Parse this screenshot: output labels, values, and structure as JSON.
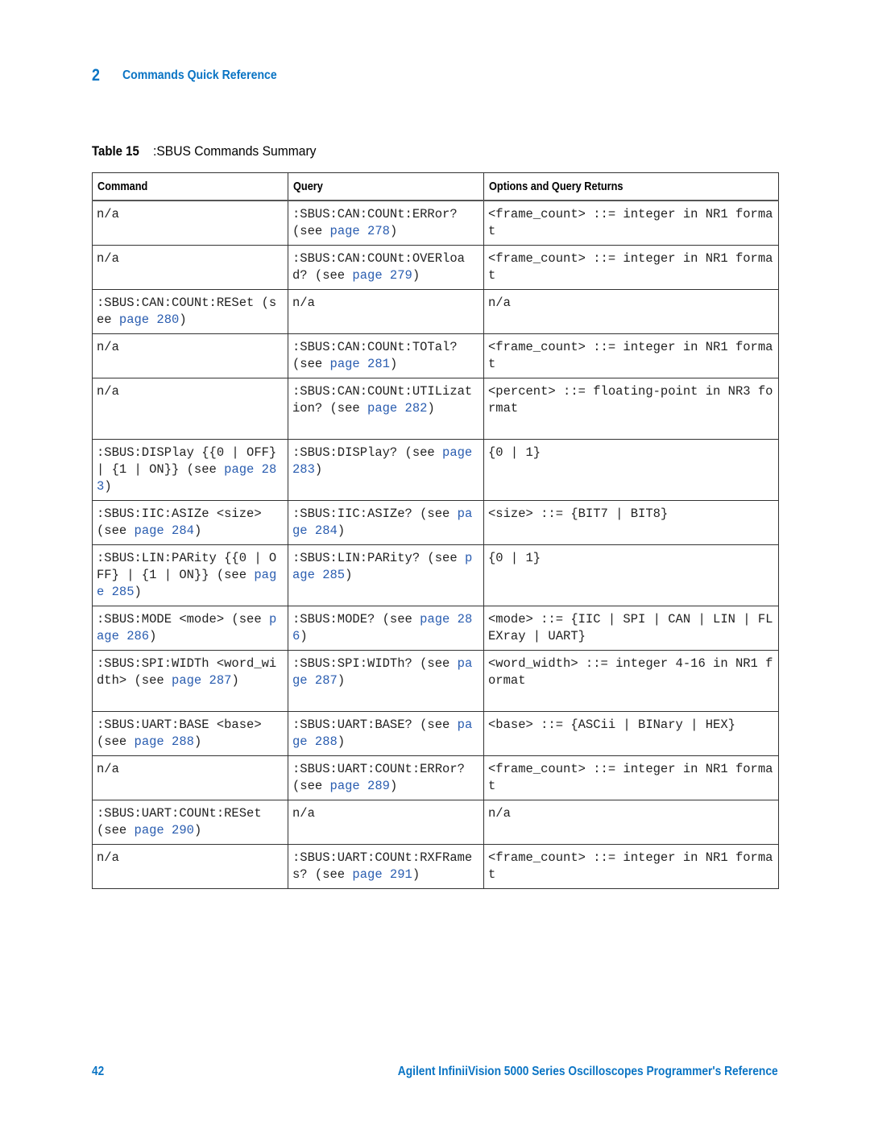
{
  "chapter": {
    "number": "2",
    "title": "Commands Quick Reference"
  },
  "caption": {
    "label": "Table 15",
    "title": ":SBUS Commands Summary"
  },
  "table": {
    "headers": [
      "Command",
      "Query",
      "Options and Query Returns"
    ],
    "link_color": "#2a5db0",
    "rows": [
      {
        "command": {
          "text": "n/a"
        },
        "query": {
          "text": ":SBUS:CAN:COUNt:ERRor? (see ",
          "link": "page 278",
          "after": ")"
        },
        "options": {
          "text": "<frame_count> ::= integer in NR1 format"
        }
      },
      {
        "command": {
          "text": "n/a"
        },
        "query": {
          "text": ":SBUS:CAN:COUNt:OVERload? (see ",
          "link": "page 279",
          "after": ")"
        },
        "options": {
          "text": "<frame_count> ::= integer in NR1 format"
        }
      },
      {
        "command": {
          "text": ":SBUS:CAN:COUNt:RESet (see ",
          "link": "page 280",
          "after": ")"
        },
        "query": {
          "text": "n/a"
        },
        "options": {
          "text": "n/a"
        }
      },
      {
        "command": {
          "text": "n/a"
        },
        "query": {
          "text": ":SBUS:CAN:COUNt:TOTal? (see ",
          "link": "page 281",
          "after": ")"
        },
        "options": {
          "text": "<frame_count> ::= integer in NR1 format"
        }
      },
      {
        "command": {
          "text": "n/a"
        },
        "query": {
          "text": ":SBUS:CAN:COUNt:UTILization? (see ",
          "link": "page 282",
          "after": ")"
        },
        "options": {
          "text": "<percent> ::= floating-point in NR3 format"
        }
      },
      {
        "command": {
          "text": ":SBUS:DISPlay {{0 | OFF} | {1 | ON}} (see ",
          "link": "page 283",
          "after": ")"
        },
        "query": {
          "text": ":SBUS:DISPlay? (see ",
          "link": "page 283",
          "after": ")"
        },
        "options": {
          "text": "{0 | 1}"
        }
      },
      {
        "command": {
          "text": ":SBUS:IIC:ASIZe <size> (see ",
          "link": "page 284",
          "after": ")"
        },
        "query": {
          "text": ":SBUS:IIC:ASIZe? (see ",
          "link": "page 284",
          "after": ")"
        },
        "options": {
          "text": "<size> ::= {BIT7 | BIT8}"
        }
      },
      {
        "command": {
          "text": ":SBUS:LIN:PARity {{0 | OFF} | {1 | ON}} (see ",
          "link": "page 285",
          "after": ")"
        },
        "query": {
          "text": ":SBUS:LIN:PARity? (see ",
          "link": "page 285",
          "after": ")"
        },
        "options": {
          "text": "{0 | 1}"
        }
      },
      {
        "command": {
          "text": ":SBUS:MODE <mode> (see ",
          "link": "page 286",
          "after": ")"
        },
        "query": {
          "text": ":SBUS:MODE? (see ",
          "link": "page 286",
          "after": ")"
        },
        "options": {
          "text": "<mode> ::= {IIC | SPI | CAN | LIN | FLEXray | UART}"
        }
      },
      {
        "command": {
          "text": ":SBUS:SPI:WIDTh <word_width> (see ",
          "link": "page 287",
          "after": ")"
        },
        "query": {
          "text": ":SBUS:SPI:WIDTh? (see ",
          "link": "page 287",
          "after": ")"
        },
        "options": {
          "text": "<word_width> ::= integer 4-16 in NR1 format"
        }
      },
      {
        "command": {
          "text": ":SBUS:UART:BASE <base> (see ",
          "link": "page 288",
          "after": ")"
        },
        "query": {
          "text": ":SBUS:UART:BASE? (see ",
          "link": "page 288",
          "after": ")"
        },
        "options": {
          "text": "<base> ::= {ASCii | BINary | HEX}"
        }
      },
      {
        "command": {
          "text": "n/a"
        },
        "query": {
          "text": ":SBUS:UART:COUNt:ERRor? (see ",
          "link": "page 289",
          "after": ")"
        },
        "options": {
          "text": "<frame_count> ::= integer in NR1 format"
        }
      },
      {
        "command": {
          "text": ":SBUS:UART:COUNt:RESet (see ",
          "link": "page 290",
          "after": ")"
        },
        "query": {
          "text": "n/a"
        },
        "options": {
          "text": "n/a"
        }
      },
      {
        "command": {
          "text": "n/a"
        },
        "query": {
          "text": ":SBUS:UART:COUNt:RXFRames? (see ",
          "link": "page 291",
          "after": ")"
        },
        "options": {
          "text": "<frame_count> ::= integer in NR1 format"
        }
      }
    ]
  },
  "footer": {
    "page_number": "42",
    "title": "Agilent InfiniiVision 5000 Series Oscilloscopes Programmer's Reference"
  },
  "colors": {
    "accent": "#0a74c4",
    "link": "#2a5db0"
  }
}
